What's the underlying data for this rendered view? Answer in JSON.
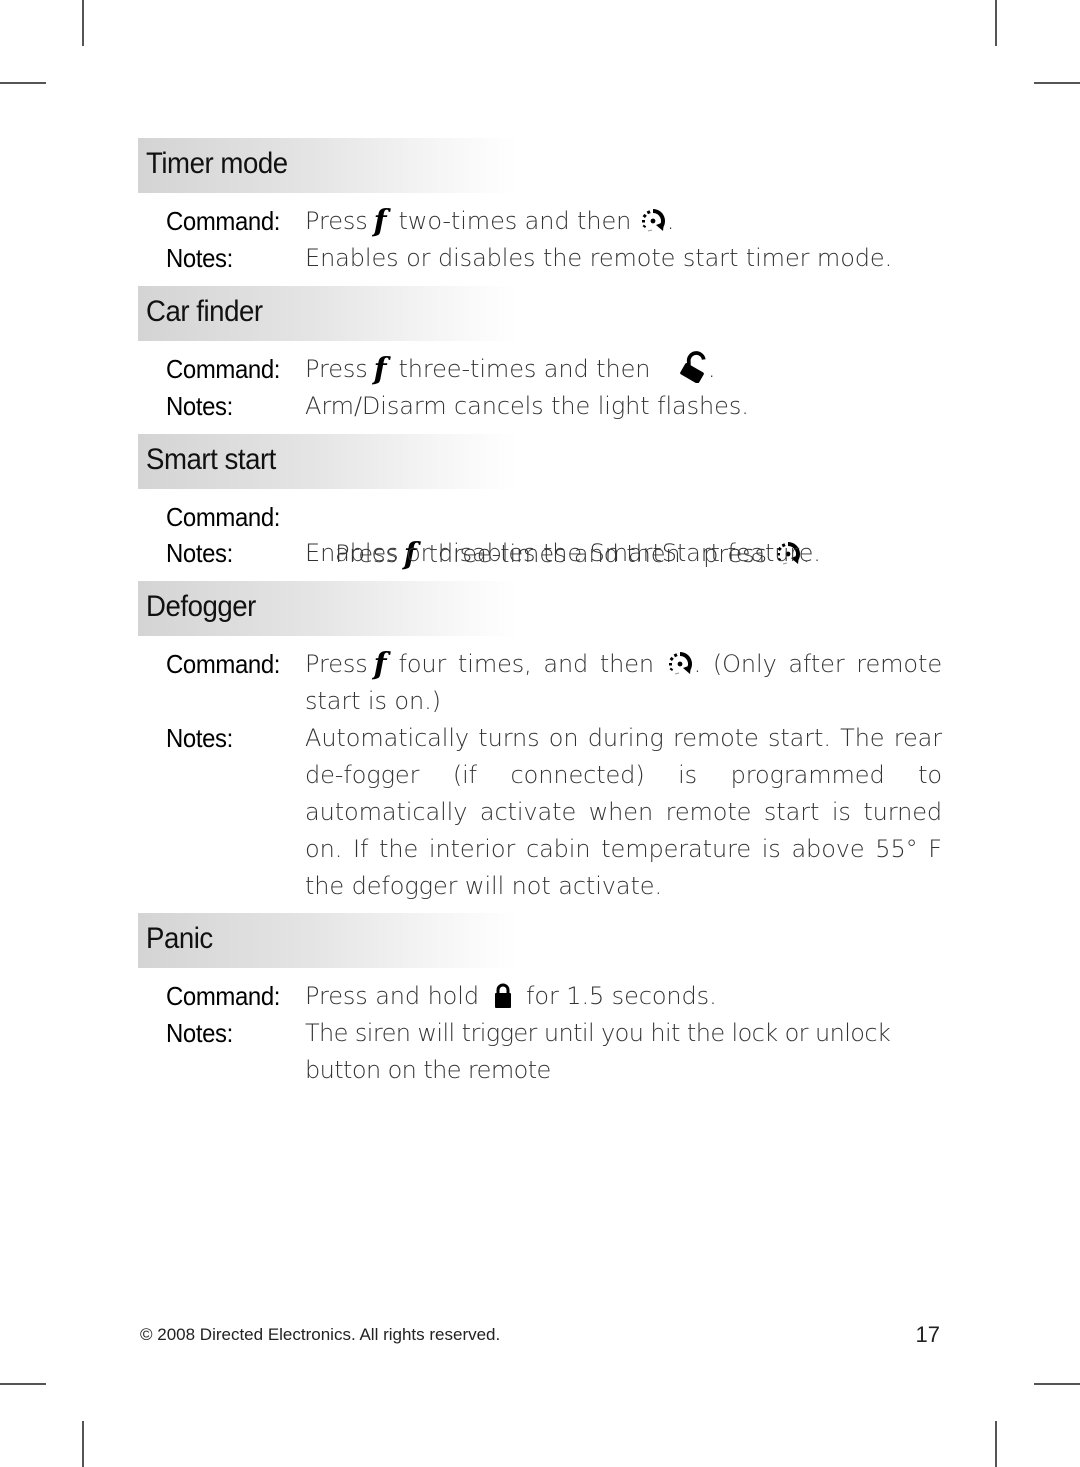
{
  "sections": [
    {
      "title": "Timer mode",
      "command_label": "Command:",
      "command": {
        "pre": "Press",
        "mid": "two-times and then",
        "post": ".",
        "icon": "remote-start-icon"
      },
      "notes_label": "Notes:",
      "notes": "Enables or disables the remote start timer mode."
    },
    {
      "title": "Car finder",
      "command_label": "Command:",
      "command": {
        "pre": "Press",
        "mid": "three-times and then",
        "post": ".",
        "icon": "unlock-icon"
      },
      "notes_label": "Notes:",
      "notes": "Arm/Disarm cancels the light flashes."
    },
    {
      "title": "Smart start",
      "command_label": "Command:",
      "command": {
        "pre": "Press",
        "mid": "three-times and then   press",
        "post": ".",
        "icon": "remote-start-icon"
      },
      "notes_label": "Notes:",
      "notes": "Enables or disables the SmartStart feature."
    },
    {
      "title": "Defogger",
      "command_label": "Command:",
      "command": {
        "pre": "Press",
        "mid": "four times, and then",
        "post": ". (Only after remote start is on.)",
        "icon": "remote-start-icon"
      },
      "notes_label": "Notes:",
      "notes": "Automatically turns on during remote start. The rear de-fogger (if connected) is programmed to automatically activate when remote start is turned on. If the interior cabin temperature is above 55° F the defogger will not activate."
    },
    {
      "title": "Panic",
      "command_label": "Command:",
      "command": {
        "pre": "Press and hold",
        "post": "for 1.5 seconds.",
        "icon": "lock-icon"
      },
      "notes_label": "Notes:",
      "notes": "The siren will trigger until you hit the lock or unlock button on the remote"
    }
  ],
  "function_key_glyph": "f",
  "footer": {
    "copyright": "© 2008 Directed Electronics. All rights reserved.",
    "page_number": "17"
  }
}
